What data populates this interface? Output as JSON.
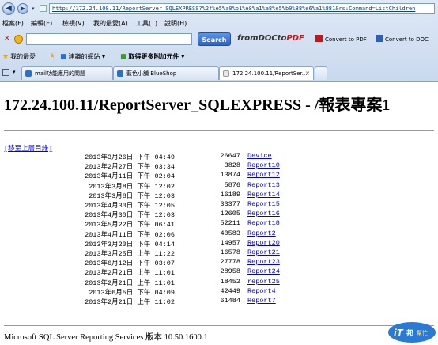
{
  "browser": {
    "address": "http://172.24.100.11/ReportServer_SQLEXPRESS?%2f%e5%a0%b1%e8%a1%a8%e5%b0%88%e6%a1%881&rs:Command=ListChildren",
    "menus": [
      "檔案(F)",
      "編輯(E)",
      "檢視(V)",
      "我的最愛(A)",
      "工具(T)",
      "說明(H)"
    ],
    "search_button": "Search",
    "fromdoc_logo": {
      "from": "from",
      "doc": "DOC",
      "to": "to",
      "pdf": "PDF"
    },
    "toolbar_buttons": [
      "Convert to PDF",
      "Convert to DOC"
    ],
    "favorites_label": "我的最愛",
    "favorites": [
      "建議的網站 ▾",
      "取得更多附加元件 ▾"
    ],
    "tabs": [
      {
        "label": "mail功能應用的問題"
      },
      {
        "label": "藍色小舖 BlueShop"
      },
      {
        "label": "172.24.100.11/ReportSer..."
      }
    ]
  },
  "page": {
    "title": "172.24.100.11/ReportServer_SQLEXPRESS - /報表專案1",
    "parent_link": "[移至上層目錄]",
    "footer": "Microsoft SQL Server Reporting Services 版本 10.50.1600.1"
  },
  "listing": [
    {
      "date": "2013年3月26日 下午 04:49",
      "size": "26647",
      "name": "Device"
    },
    {
      "date": "2013年2月27日 下午 03:34",
      "size": "3828",
      "name": "Report10"
    },
    {
      "date": "2013年4月11日 下午 02:04",
      "size": "13874",
      "name": "Report12"
    },
    {
      "date": "2013年3月8日 下午 12:02",
      "size": "5876",
      "name": "Report13"
    },
    {
      "date": "2013年3月8日 下午 12:03",
      "size": "16189",
      "name": "Report14"
    },
    {
      "date": "2013年4月30日 下午 12:05",
      "size": "33377",
      "name": "Report15"
    },
    {
      "date": "2013年4月30日 下午 12:03",
      "size": "12605",
      "name": "Report16"
    },
    {
      "date": "2013年5月22日 下午 06:41",
      "size": "52211",
      "name": "Report18"
    },
    {
      "date": "2013年4月11日 下午 02:06",
      "size": "40583",
      "name": "Report2"
    },
    {
      "date": "2013年3月20日 下午 04:14",
      "size": "14957",
      "name": "Report20"
    },
    {
      "date": "2013年3月25日 上午 11:22",
      "size": "16578",
      "name": "Report21"
    },
    {
      "date": "2013年6月12日 下午 03:07",
      "size": "27778",
      "name": "Report23"
    },
    {
      "date": "2013年2月21日 上午 11:01",
      "size": "28958",
      "name": "Report24"
    },
    {
      "date": "2013年2月21日 上午 11:01",
      "size": "18452",
      "name": "report25"
    },
    {
      "date": "2013年6月5日 下午 04:09",
      "size": "42449",
      "name": "Report4"
    },
    {
      "date": "2013年2月21日 上午 11:02",
      "size": "61484",
      "name": "Report7"
    }
  ],
  "watermark": {
    "text1": "iT",
    "text2": "邦",
    "text3": "幫忙"
  }
}
